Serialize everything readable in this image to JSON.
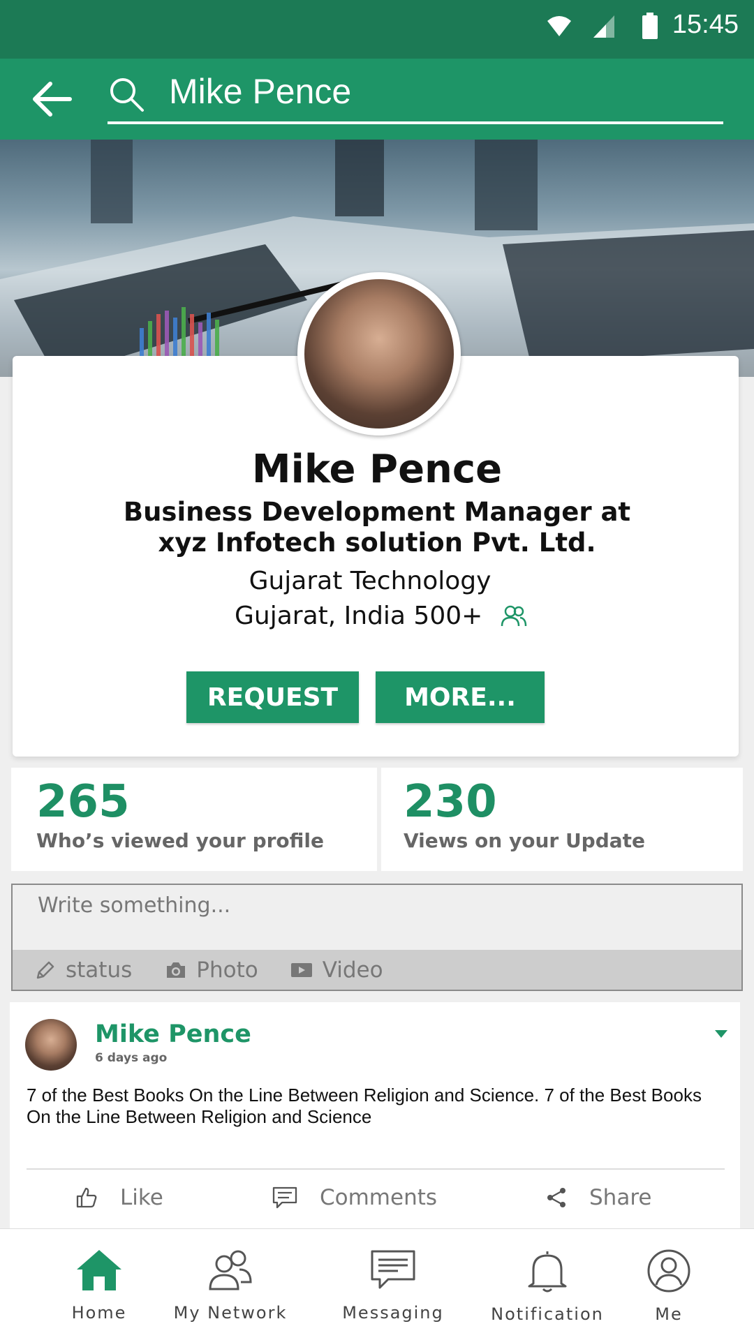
{
  "status_bar": {
    "time": "15:45"
  },
  "search": {
    "query": "Mike Pence"
  },
  "profile": {
    "name": "Mike Pence",
    "headline_line1": "Business Development Manager at",
    "headline_line2": "xyz Infotech solution Pvt. Ltd.",
    "company": "Gujarat Technology",
    "location": "Gujarat, India 500+",
    "buttons": {
      "request": "REQUEST",
      "more": "MORE..."
    }
  },
  "stats": [
    {
      "value": "265",
      "label": "Who’s viewed your profile"
    },
    {
      "value": "230",
      "label": "Views on your Update"
    }
  ],
  "composer": {
    "placeholder": "Write something...",
    "tools": {
      "status": "status",
      "photo": "Photo",
      "video": "Video"
    }
  },
  "post": {
    "author": "Mike Pence",
    "time": "6 days ago",
    "text": "7 of the Best Books On the Line Between Religion and Science. 7 of the Best Books On the Line Between Religion and Science",
    "actions": {
      "like": "Like",
      "comments": "Comments",
      "share": "Share"
    }
  },
  "bottom_nav": {
    "home": "Home",
    "network": "My Network",
    "messaging": "Messaging",
    "notification": "Notification",
    "me": "Me"
  },
  "colors": {
    "primary": "#1e9567",
    "status_bar": "#1c7a55"
  },
  "icons": [
    "wifi-icon",
    "signal-icon",
    "battery-icon",
    "back-arrow-icon",
    "search-icon",
    "people-icon",
    "pencil-icon",
    "camera-icon",
    "video-icon",
    "thumbs-up-icon",
    "comment-icon",
    "share-icon",
    "home-icon",
    "network-icon",
    "messaging-icon",
    "bell-icon",
    "profile-icon"
  ]
}
